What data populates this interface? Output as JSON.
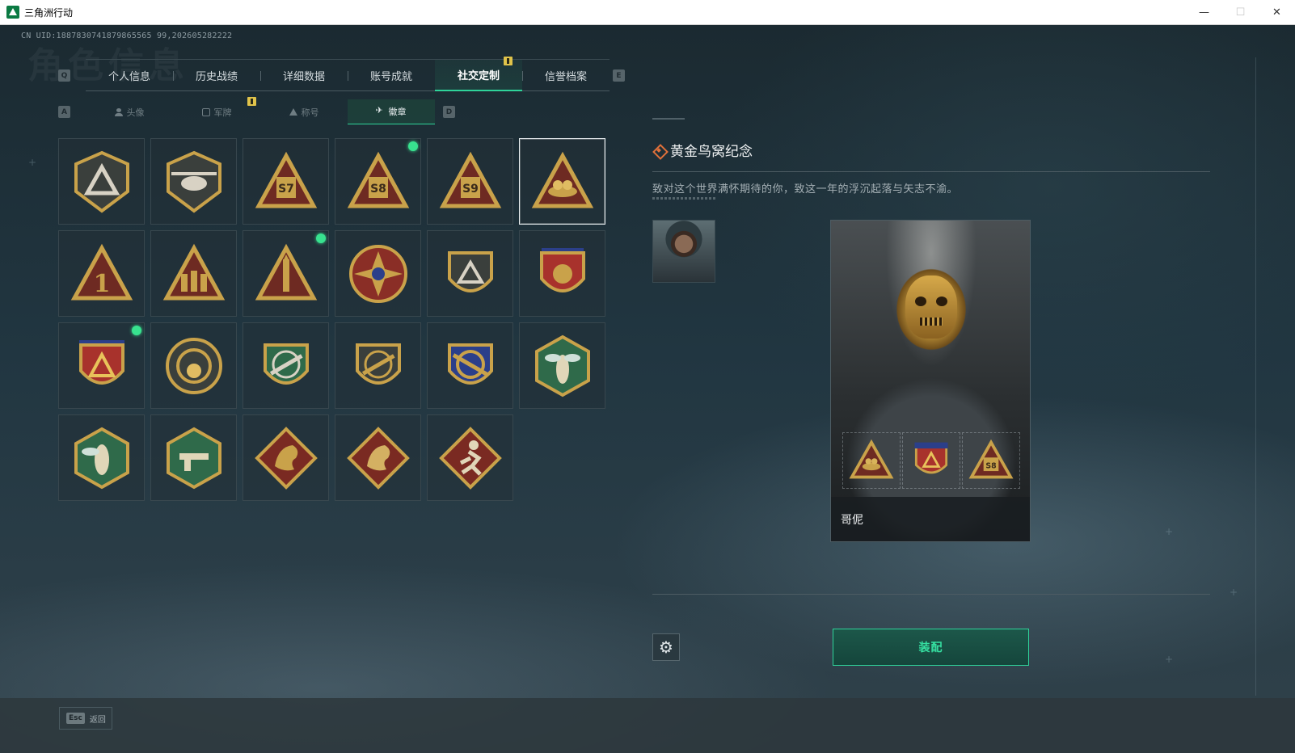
{
  "window": {
    "title": "三角洲行动",
    "minimize": "—",
    "maximize": "☐",
    "close": "✕"
  },
  "header": {
    "uid": "CN UID:1887830741879865565 99,202605282222",
    "bg_title": "角色信息"
  },
  "key_hints": {
    "tab_prev": "Q",
    "tab_next": "E",
    "sub_prev": "A",
    "sub_next": "D"
  },
  "tabs": [
    {
      "label": "个人信息",
      "active": false
    },
    {
      "label": "历史战绩",
      "active": false
    },
    {
      "label": "详细数据",
      "active": false
    },
    {
      "label": "账号成就",
      "active": false
    },
    {
      "label": "社交定制",
      "active": true
    },
    {
      "label": "信誉档案",
      "active": false
    }
  ],
  "subtabs": [
    {
      "label": "头像",
      "icon": "head-icon",
      "active": false
    },
    {
      "label": "军牌",
      "icon": "plate-icon",
      "active": false
    },
    {
      "label": "称号",
      "icon": "triangle-icon",
      "active": false
    },
    {
      "label": "徽章",
      "icon": "wing-icon",
      "active": true
    }
  ],
  "badges": [
    {
      "icon": "triangle-shield-badge",
      "new": false,
      "selected": false
    },
    {
      "icon": "helicopter-badge",
      "new": false,
      "selected": false
    },
    {
      "icon": "s7-badge",
      "text": "S7",
      "new": false,
      "selected": false
    },
    {
      "icon": "s8-badge",
      "text": "S8",
      "new": true,
      "selected": false
    },
    {
      "icon": "s9-badge",
      "text": "S9",
      "new": false,
      "selected": false
    },
    {
      "icon": "golden-nest-badge",
      "new": false,
      "selected": true
    },
    {
      "icon": "rank-one-badge",
      "text": "1",
      "new": false,
      "selected": false
    },
    {
      "icon": "squad-badge",
      "new": false,
      "selected": false
    },
    {
      "icon": "rocket-badge",
      "new": true,
      "selected": false
    },
    {
      "icon": "star-compass-badge",
      "new": false,
      "selected": false
    },
    {
      "icon": "operator-shield-badge",
      "new": false,
      "selected": false
    },
    {
      "icon": "laurel-shield-badge",
      "new": false,
      "selected": false
    },
    {
      "icon": "star-banner-badge",
      "new": true,
      "selected": false
    },
    {
      "icon": "orb-ring-badge",
      "new": false,
      "selected": false
    },
    {
      "icon": "green-rifle-badge",
      "new": false,
      "selected": false
    },
    {
      "icon": "rifle-ring-badge",
      "new": false,
      "selected": false
    },
    {
      "icon": "crossed-rifle-badge",
      "new": false,
      "selected": false
    },
    {
      "icon": "wasp-hex-badge",
      "new": false,
      "selected": false
    },
    {
      "icon": "hornet-hex-badge",
      "new": false,
      "selected": false
    },
    {
      "icon": "gun-hex-badge",
      "new": false,
      "selected": false
    },
    {
      "icon": "dragon-red-badge",
      "new": false,
      "selected": false
    },
    {
      "icon": "dragon-red-2-badge",
      "new": false,
      "selected": false
    },
    {
      "icon": "runner-red-badge",
      "new": false,
      "selected": false
    }
  ],
  "detail": {
    "title": "黄金鸟窝纪念",
    "description": "致对这个世界满怀期待的你，致这一年的浮沉起落与矢志不渝。",
    "operator_name": "哥伲",
    "equip_label": "装配"
  },
  "footer": {
    "esc_key": "Esc",
    "esc_label": "返回"
  },
  "colors": {
    "accent": "#2fd39a",
    "gold": "#c9a24a",
    "notice": "#e0c34a",
    "new_dot": "#38e28f"
  }
}
